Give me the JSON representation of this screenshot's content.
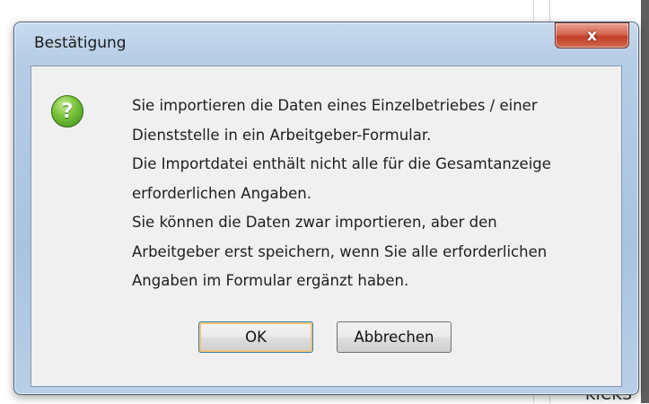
{
  "dialog": {
    "title": "Bestätigung",
    "close_label": "x",
    "icon": "question-icon",
    "message_lines": [
      "Sie importieren die Daten eines Einzelbetriebes / einer",
      "Dienststelle in ein Arbeitgeber-Formular.",
      "Die Importdatei enthält nicht alle für die Gesamtanzeige",
      "erforderlichen Angaben.",
      "Sie können die Daten zwar importieren, aber den",
      "Arbeitgeber erst speichern, wenn Sie alle erforderlichen",
      "Angaben im Formular ergänzt haben."
    ],
    "ok_label": "OK",
    "cancel_label": "Abbrechen"
  },
  "background": {
    "partial_text": "KICKS"
  }
}
